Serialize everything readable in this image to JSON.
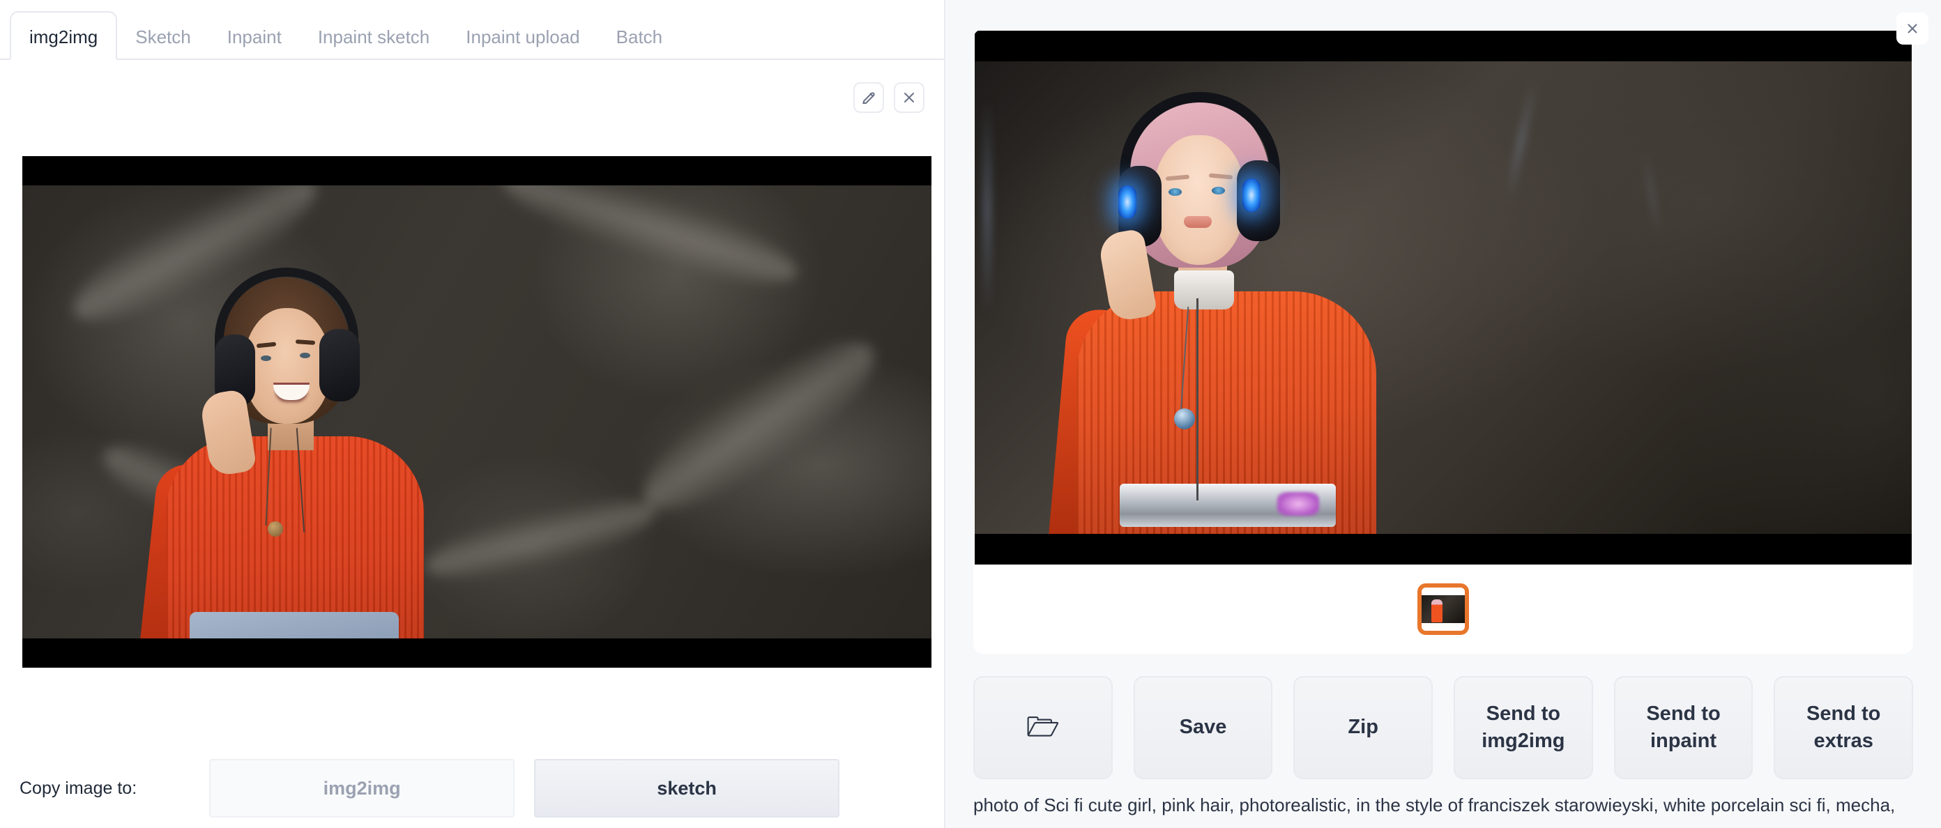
{
  "theme": {
    "accent_orange": "#e8762b",
    "page_bg": "#f7f8fa",
    "panel_bg": "#ffffff",
    "text": "#2b3445",
    "muted": "#9aa1b1"
  },
  "tabs": [
    {
      "label": "img2img",
      "active": true
    },
    {
      "label": "Sketch",
      "active": false
    },
    {
      "label": "Inpaint",
      "active": false
    },
    {
      "label": "Inpaint sketch",
      "active": false
    },
    {
      "label": "Inpaint upload",
      "active": false
    },
    {
      "label": "Batch",
      "active": false
    }
  ],
  "source_tools": {
    "edit_icon": "pencil-icon",
    "close_icon": "close-icon"
  },
  "source_image": {
    "alt": "photo of smiling woman wearing black over-ear headphones and a red ribbed sweater with pendant necklaces, dark mottled grey background, letterboxed"
  },
  "copy_image": {
    "label": "Copy image to:",
    "targets": [
      {
        "label": "img2img",
        "state": "disabled"
      },
      {
        "label": "sketch",
        "state": "enabled"
      }
    ]
  },
  "gallery": {
    "close_icon": "close-icon",
    "result_image": {
      "alt": "AI generated sci-fi girl with pink hair, blue glowing headphones, orange ribbed sweater, white porcelain collar and chrome sci-fi belt, dark background, letterboxed"
    },
    "thumbnails": [
      {
        "selected": true,
        "alt": "thumbnail of generated sci-fi girl"
      }
    ]
  },
  "actions": [
    {
      "label": "",
      "icon": "open-folder-icon",
      "glyph": "🗁"
    },
    {
      "label": "Save",
      "icon": null
    },
    {
      "label": "Zip",
      "icon": null
    },
    {
      "label": "Send to img2img",
      "icon": null
    },
    {
      "label": "Send to inpaint",
      "icon": null
    },
    {
      "label": "Send to extras",
      "icon": null
    }
  ],
  "prompt": {
    "text": "photo of Sci fi cute girl, pink hair, photorealistic, in the style of franciszek starowieyski, white porcelain sci fi, mecha,"
  }
}
